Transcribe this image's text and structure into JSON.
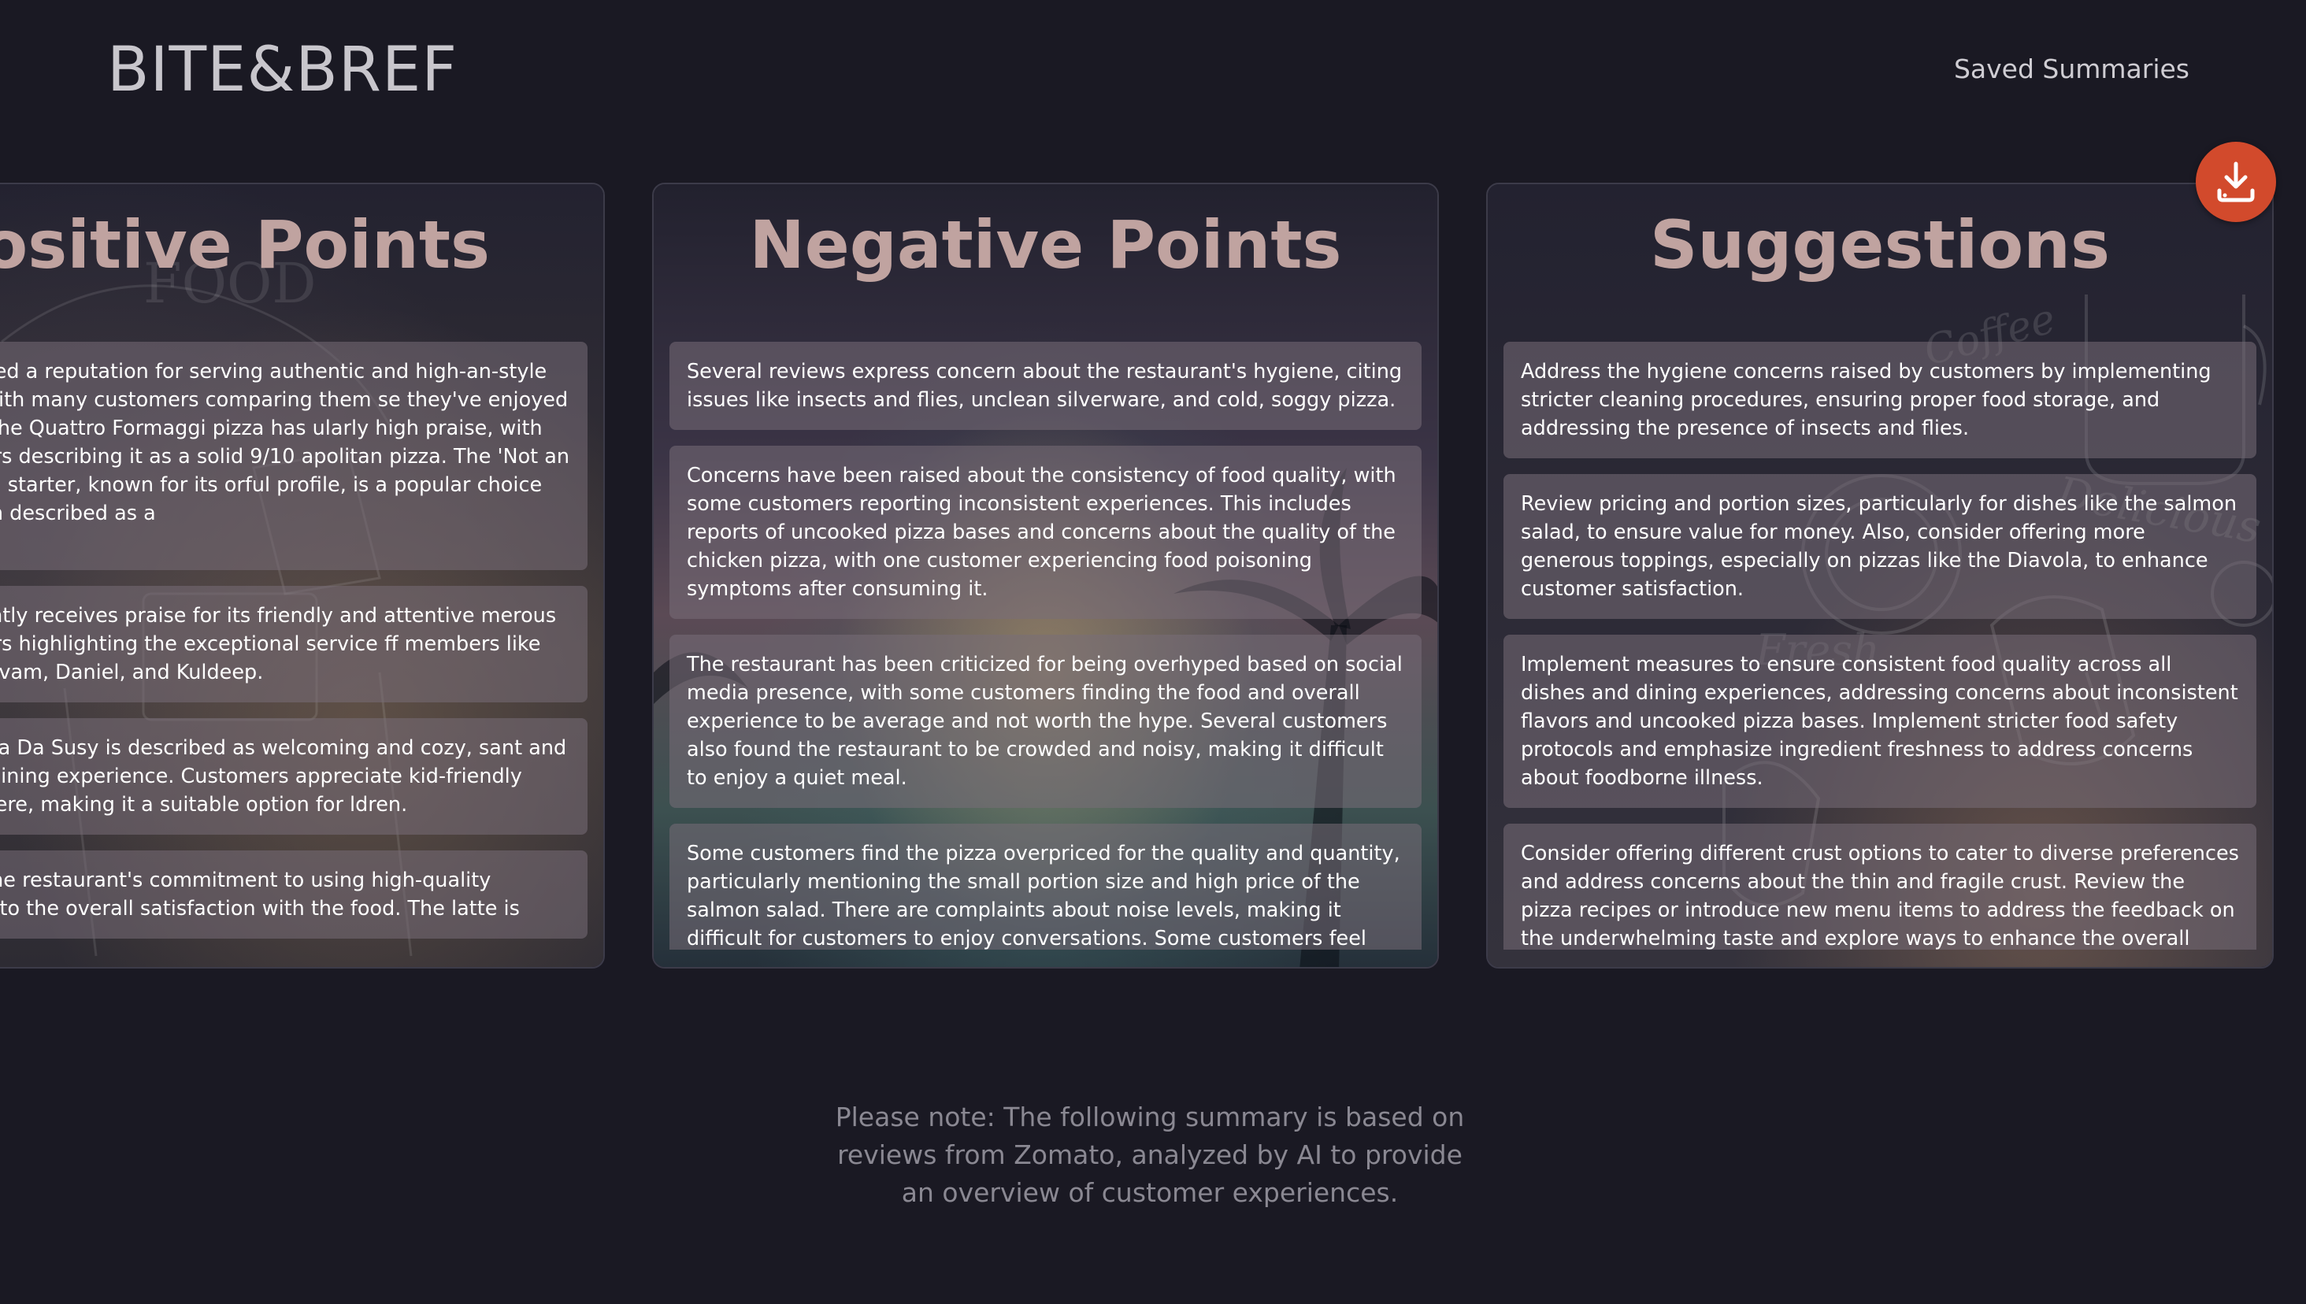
{
  "header": {
    "brand": "BITE&BREF",
    "nav_saved": "Saved Summaries"
  },
  "positive": {
    "title": "Positive Points",
    "items": [
      "has earned a reputation for serving authentic and high-an-style pizzas, with many customers comparing them se they've enjoyed in Italy. The Quattro Formaggi pizza has ularly high praise, with customers describing it as a solid 9/10 apolitan pizza. The 'Not an Arancino' starter, known for its orful profile, is a popular choice and often described as a",
      "consistently receives praise for its friendly and attentive merous customers highlighting the exceptional service ff members like Feba, Shivam, Daniel, and Kuldeep.",
      "at Pizzeria Da Susy is described as welcoming and cozy, sant and inviting dining experience. Customers appreciate kid-friendly atmosphere, making it a suitable option for ldren.",
      "reciate the restaurant's commitment to using high-quality tributing to the overall satisfaction with the food. The latte is"
    ]
  },
  "negative": {
    "title": "Negative Points",
    "items": [
      "Several reviews express concern about the restaurant's hygiene, citing issues like insects and flies, unclean silverware, and cold, soggy pizza.",
      "Concerns have been raised about the consistency of food quality, with some customers reporting inconsistent experiences. This includes reports of uncooked pizza bases and concerns about the quality of the chicken pizza, with one customer experiencing food poisoning symptoms after consuming it.",
      "The restaurant has been criticized for being overhyped based on social media presence, with some customers finding the food and overall experience to be average and not worth the hype. Several customers also found the restaurant to be crowded and noisy, making it difficult to enjoy a quiet meal.",
      "Some customers find the pizza overpriced for the quality and quantity, particularly mentioning the small portion size and high price of the salmon salad. There are complaints about noise levels, making it difficult for customers to enjoy conversations. Some customers feel that the portion size"
    ]
  },
  "suggestions": {
    "title": "Suggestions",
    "items": [
      "Address the hygiene concerns raised by customers by implementing stricter cleaning procedures, ensuring proper food storage, and addressing the presence of insects and flies.",
      "Review pricing and portion sizes, particularly for dishes like the salmon salad, to ensure value for money. Also, consider offering more generous toppings, especially on pizzas like the Diavola, to enhance customer satisfaction.",
      "Implement measures to ensure consistent food quality across all dishes and dining experiences, addressing concerns about inconsistent flavors and uncooked pizza bases. Implement stricter food safety protocols and emphasize ingredient freshness to address concerns about foodborne illness.",
      "Consider offering different crust options to cater to diverse preferences and address concerns about the thin and fragile crust. Review the pizza recipes or introduce new menu items to address the feedback on the underwhelming taste and explore ways to enhance the overall flavor profile"
    ]
  },
  "note": "Please note: The following summary is based on reviews from Zomato, analyzed by AI to provide an overview of customer experiences.",
  "icons": {
    "download": "download-icon"
  },
  "colors": {
    "background": "#1a1923",
    "title": "#c0a3a0",
    "download_button": "#d24a2c"
  }
}
